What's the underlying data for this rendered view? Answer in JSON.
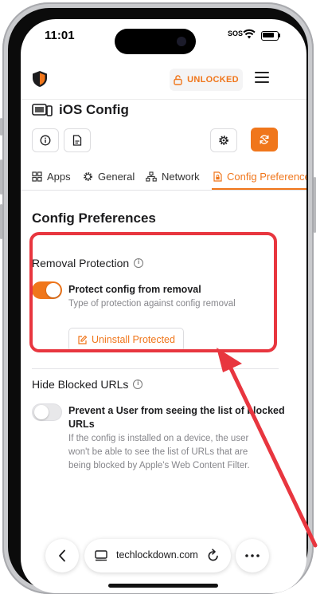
{
  "status_bar": {
    "time": "11:01",
    "sos": "SOS"
  },
  "header": {
    "lock_button_label": "UNLOCKED"
  },
  "page": {
    "title": "iOS Config"
  },
  "tabs": [
    {
      "label": "Apps"
    },
    {
      "label": "General"
    },
    {
      "label": "Network"
    },
    {
      "label": "Config Preferences",
      "active": true
    }
  ],
  "section": {
    "title": "Config Preferences"
  },
  "removal_protection": {
    "label": "Removal Protection",
    "toggle_on": true,
    "option_title": "Protect config from removal",
    "option_desc": "Type of protection against config removal",
    "button_label": "Uninstall Protected"
  },
  "hide_blocked_urls": {
    "label": "Hide Blocked URLs",
    "toggle_on": false,
    "option_title_line1": "Prevent a User from seeing the list of blocked",
    "option_title_line2": "URLs",
    "option_desc_line1": "If the config is installed on a device, the user",
    "option_desc_line2": "won't be able to see the list of URLs that are",
    "option_desc_line3": "being blocked by Apple's Web Content Filter."
  },
  "browser": {
    "url": "techlockdown.com"
  },
  "colors": {
    "accent": "#f0761b",
    "highlight": "#e8363f"
  }
}
